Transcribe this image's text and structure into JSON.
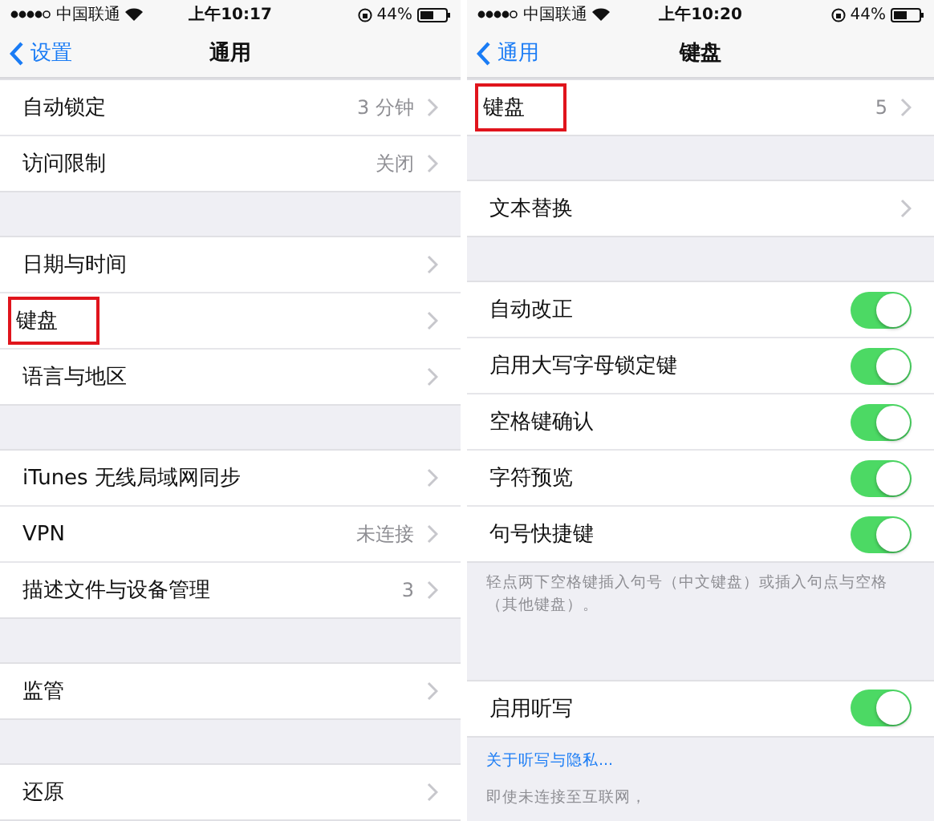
{
  "screens": [
    {
      "status_bar": {
        "carrier": "中国联通",
        "time": "上午10:17",
        "battery": "44%"
      },
      "nav": {
        "back": "设置",
        "title": "通用"
      },
      "sections": [
        {
          "rows": [
            {
              "kind": "disclosure",
              "label": "自动锁定",
              "value": "3 分钟",
              "highlighted": false
            },
            {
              "kind": "disclosure",
              "label": "访问限制",
              "value": "关闭",
              "highlighted": false
            }
          ]
        },
        {
          "rows": [
            {
              "kind": "disclosure",
              "label": "日期与时间",
              "highlighted": false
            },
            {
              "kind": "disclosure",
              "label": "键盘",
              "highlighted": true
            },
            {
              "kind": "disclosure",
              "label": "语言与地区",
              "highlighted": false
            }
          ]
        },
        {
          "rows": [
            {
              "kind": "disclosure",
              "label": "iTunes 无线局域网同步",
              "highlighted": false
            },
            {
              "kind": "disclosure",
              "label": "VPN",
              "value": "未连接",
              "highlighted": false
            },
            {
              "kind": "disclosure",
              "label": "描述文件与设备管理",
              "value": "3",
              "highlighted": false
            }
          ]
        },
        {
          "rows": [
            {
              "kind": "disclosure",
              "label": "监管",
              "highlighted": false
            }
          ]
        },
        {
          "rows": [
            {
              "kind": "disclosure",
              "label": "还原",
              "highlighted": false
            }
          ]
        }
      ]
    },
    {
      "status_bar": {
        "carrier": "中国联通",
        "time": "上午10:20",
        "battery": "44%"
      },
      "nav": {
        "back": "通用",
        "title": "键盘"
      },
      "sections": [
        {
          "rows": [
            {
              "kind": "disclosure",
              "label": "键盘",
              "value": "5",
              "highlighted": true
            }
          ]
        },
        {
          "rows": [
            {
              "kind": "disclosure",
              "label": "文本替换",
              "highlighted": false
            }
          ]
        },
        {
          "rows": [
            {
              "kind": "toggle",
              "label": "自动改正",
              "on": true,
              "highlighted": false
            },
            {
              "kind": "toggle",
              "label": "启用大写字母锁定键",
              "on": true,
              "highlighted": false
            },
            {
              "kind": "toggle",
              "label": "空格键确认",
              "on": true,
              "highlighted": false
            },
            {
              "kind": "toggle",
              "label": "字符预览",
              "on": true,
              "highlighted": false
            },
            {
              "kind": "toggle",
              "label": "句号快捷键",
              "on": true,
              "highlighted": false
            }
          ],
          "footer": [
            {
              "kind": "text",
              "text": "轻点两下空格键插入句号（中文键盘）或插入句点与空格（其他键盘）。"
            }
          ]
        },
        {
          "rows": [
            {
              "kind": "toggle",
              "label": "启用听写",
              "on": true,
              "highlighted": false
            }
          ],
          "footer": [
            {
              "kind": "link",
              "text": "关于听写与隐私..."
            },
            {
              "kind": "text",
              "text": "即使未连接至互联网，"
            }
          ]
        }
      ]
    }
  ]
}
